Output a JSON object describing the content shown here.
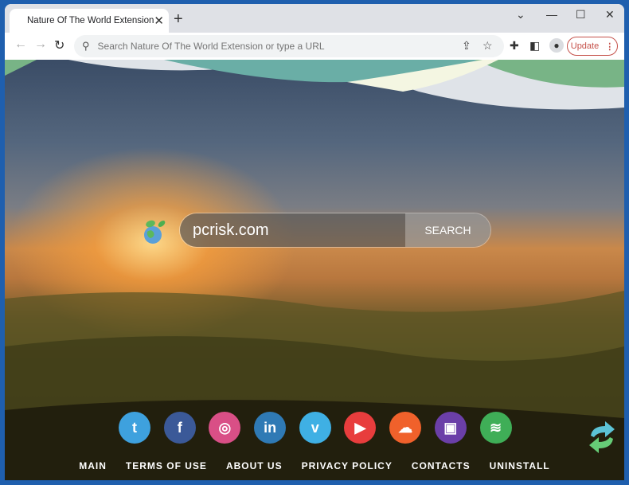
{
  "browser": {
    "tab_title": "Nature Of The World Extension",
    "address_placeholder": "Search Nature Of The World Extension or type a URL",
    "update_label": "Update"
  },
  "search": {
    "value": "pcrisk.com",
    "button_label": "SEARCH"
  },
  "socials": [
    {
      "name": "twitter",
      "color": "#3ea1de",
      "glyph": "t"
    },
    {
      "name": "facebook",
      "color": "#3b5998",
      "glyph": "f"
    },
    {
      "name": "instagram",
      "color": "#d94f86",
      "glyph": "◎"
    },
    {
      "name": "linkedin",
      "color": "#2f7ab5",
      "glyph": "in"
    },
    {
      "name": "vimeo",
      "color": "#3fb0e4",
      "glyph": "v"
    },
    {
      "name": "youtube",
      "color": "#e83d3d",
      "glyph": "▶"
    },
    {
      "name": "soundcloud",
      "color": "#f0612b",
      "glyph": "☁"
    },
    {
      "name": "twitch",
      "color": "#6b3fa8",
      "glyph": "▣"
    },
    {
      "name": "spotify",
      "color": "#3fae57",
      "glyph": "≋"
    }
  ],
  "footer": {
    "links": [
      "MAIN",
      "TERMS OF USE",
      "ABOUT US",
      "PRIVACY POLICY",
      "CONTACTS",
      "UNINSTALL"
    ]
  }
}
